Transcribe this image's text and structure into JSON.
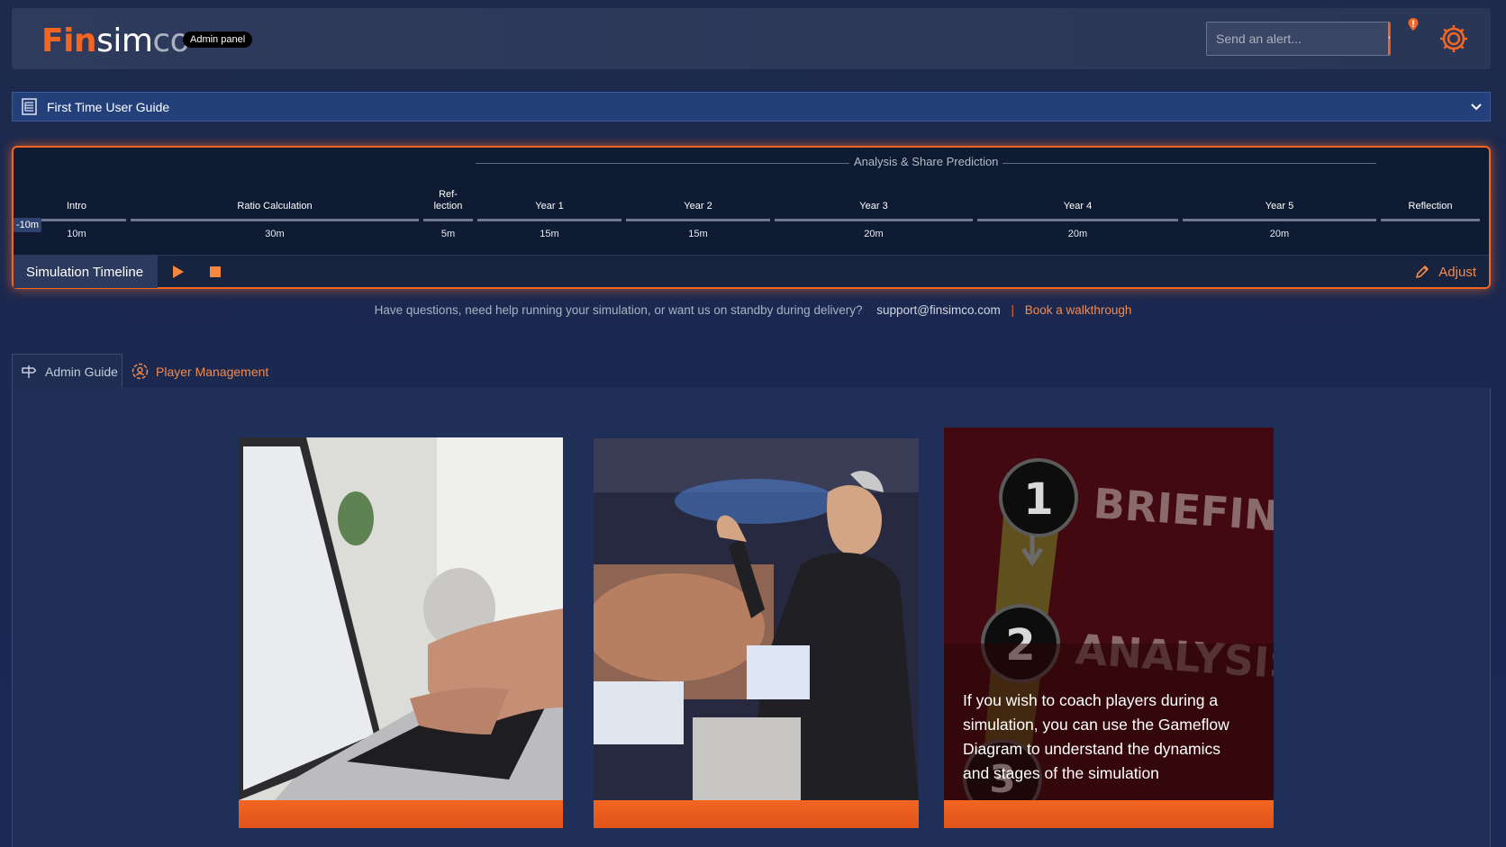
{
  "header": {
    "logo_fin": "Fin",
    "logo_sim": "sim",
    "logo_co": "co",
    "badge": "Admin panel",
    "alert_placeholder": "Send an alert...",
    "accent_color": "#f26522"
  },
  "guide": {
    "title": "First Time User Guide"
  },
  "timeline": {
    "group_label": "Analysis & Share Prediction",
    "offset_label": "-10m",
    "segments": [
      {
        "name": "Intro",
        "duration": "10m"
      },
      {
        "name": "Ratio Calculation",
        "duration": "30m"
      },
      {
        "name": "Ref-\nlection",
        "duration": "5m"
      },
      {
        "name": "Year 1",
        "duration": "15m"
      },
      {
        "name": "Year 2",
        "duration": "15m"
      },
      {
        "name": "Year 3",
        "duration": "20m"
      },
      {
        "name": "Year 4",
        "duration": "20m"
      },
      {
        "name": "Year 5",
        "duration": "20m"
      },
      {
        "name": "Reflection",
        "duration": ""
      }
    ],
    "footer_label": "Simulation Timeline",
    "adjust_label": "Adjust"
  },
  "help": {
    "question": "Have questions, need help running your simulation, or want us on standby during delivery?",
    "email": "support@finsimco.com",
    "separator": "|",
    "walkthrough": "Book a walkthrough"
  },
  "tabs": [
    {
      "label": "Admin Guide",
      "icon": "signpost-icon"
    },
    {
      "label": "Player Management",
      "icon": "user-gear-icon"
    }
  ],
  "cards": {
    "card3_caption": "If you wish to coach players during a simulation, you can use the Gameflow Diagram to understand the dynamics and stages of the simulation",
    "card3_image_text": [
      "1",
      "BRIEFING",
      "2",
      "ANALYSIS",
      "3"
    ]
  }
}
